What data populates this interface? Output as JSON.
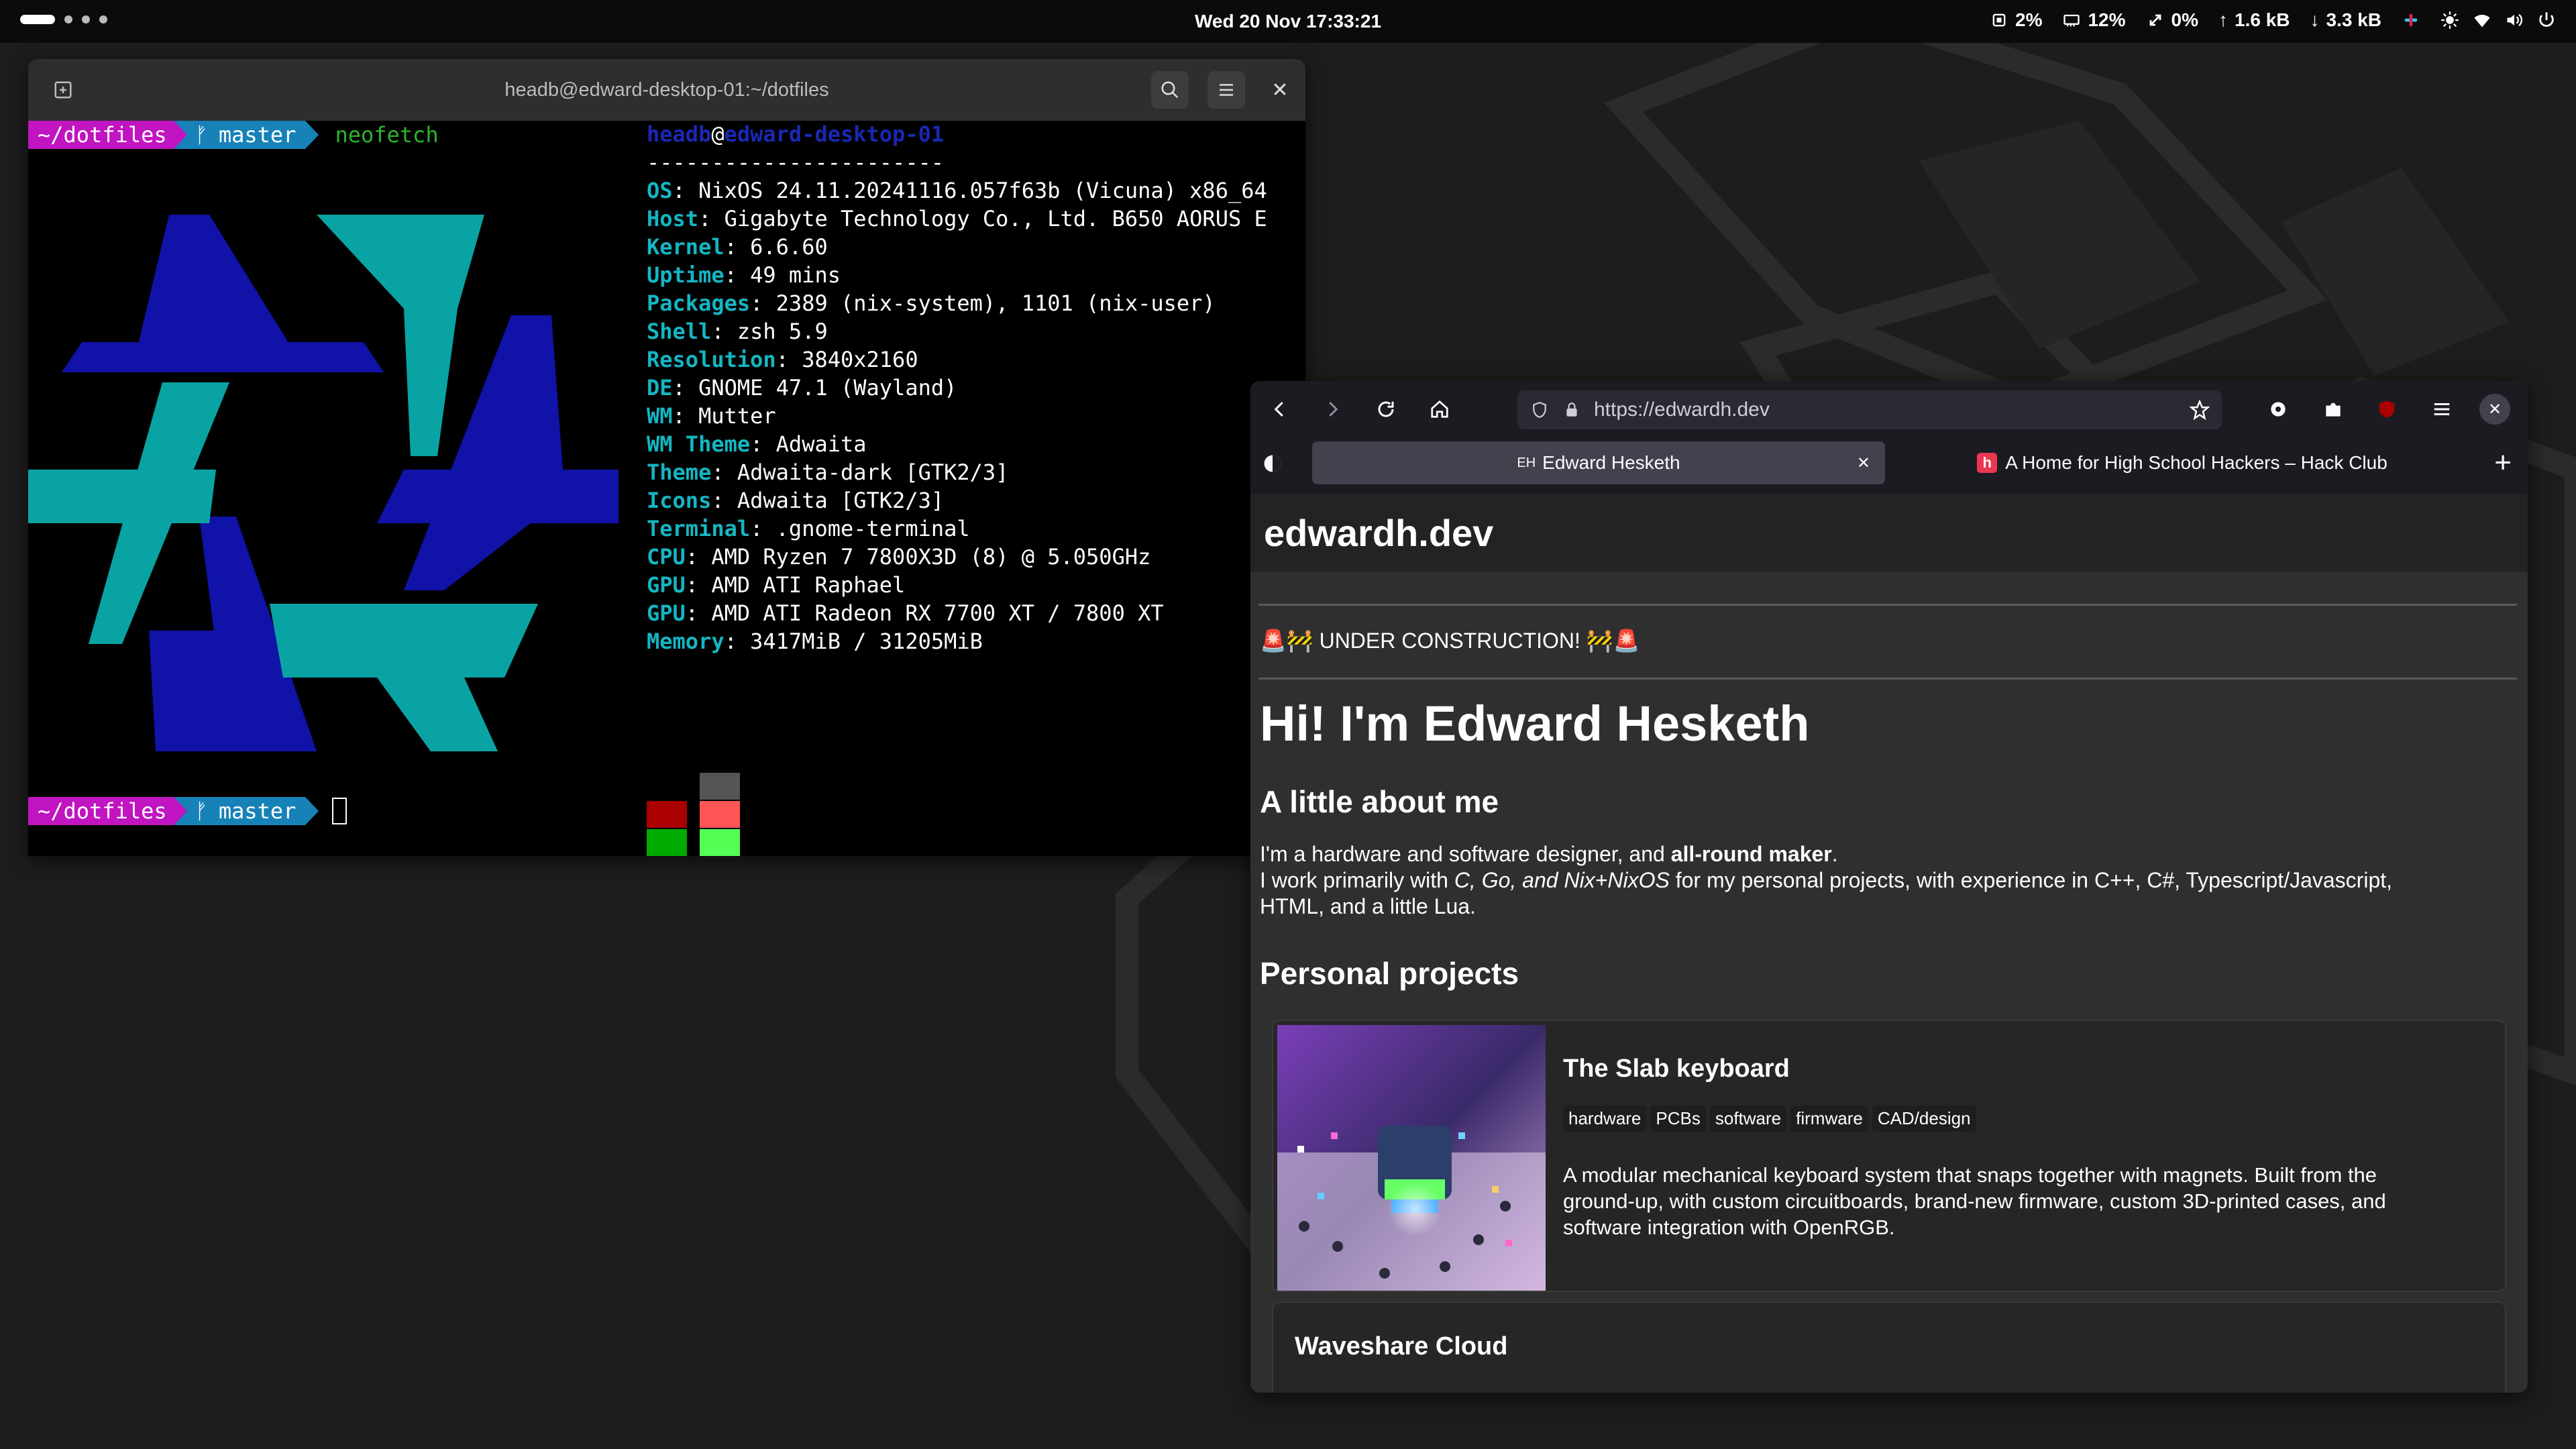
{
  "topbar": {
    "datetime": "Wed 20 Nov  17:33:21",
    "cpu": "2%",
    "ram": "12%",
    "swap": "0%",
    "net_up": "1.6 kB",
    "net_down": "3.3 kB"
  },
  "terminal": {
    "title": "headb@edward-desktop-01:~/dotfiles",
    "prompt_dir": "~/dotfiles",
    "prompt_branch": "master",
    "command": "neofetch",
    "user": "headb",
    "host": "edward-desktop-01",
    "separator": "-----------------------",
    "info": [
      {
        "key": "OS",
        "value": "NixOS 24.11.20241116.057f63b (Vicuna) x86_64"
      },
      {
        "key": "Host",
        "value": "Gigabyte Technology Co., Ltd. B650 AORUS E"
      },
      {
        "key": "Kernel",
        "value": "6.6.60"
      },
      {
        "key": "Uptime",
        "value": "49 mins"
      },
      {
        "key": "Packages",
        "value": "2389 (nix-system), 1101 (nix-user)"
      },
      {
        "key": "Shell",
        "value": "zsh 5.9"
      },
      {
        "key": "Resolution",
        "value": "3840x2160"
      },
      {
        "key": "DE",
        "value": "GNOME 47.1 (Wayland)"
      },
      {
        "key": "WM",
        "value": "Mutter"
      },
      {
        "key": "WM Theme",
        "value": "Adwaita"
      },
      {
        "key": "Theme",
        "value": "Adwaita-dark [GTK2/3]"
      },
      {
        "key": "Icons",
        "value": "Adwaita [GTK2/3]"
      },
      {
        "key": "Terminal",
        "value": ".gnome-terminal"
      },
      {
        "key": "CPU",
        "value": "AMD Ryzen 7 7800X3D (8) @ 5.050GHz"
      },
      {
        "key": "GPU",
        "value": "AMD ATI Raphael"
      },
      {
        "key": "GPU",
        "value": "AMD ATI Radeon RX 7700 XT / 7800 XT"
      },
      {
        "key": "Memory",
        "value": "3417MiB / 31205MiB"
      }
    ],
    "palette_top": [
      "#000000",
      "#aa0000",
      "#00aa00",
      "#aa5500",
      "#0000aa",
      "#aa00aa",
      "#00aaaa",
      "#aaaaaa"
    ],
    "palette_bottom": [
      "#555555",
      "#ff5555",
      "#55ff55",
      "#ffff55",
      "#5555ff",
      "#ff55ff",
      "#55ffff",
      "#ffffff"
    ]
  },
  "browser": {
    "url": "https://edwardh.dev",
    "tabs": [
      {
        "label": "Edward Hesketh",
        "favicon": "EH"
      },
      {
        "label": "A Home for High School Hackers – Hack Club",
        "favicon": "h"
      }
    ],
    "page": {
      "site_title": "edwardh.dev",
      "banner": "🚨🚧 UNDER CONSTRUCTION! 🚧🚨",
      "heading": "Hi! I'm Edward Hesketh",
      "about_heading": "A little about me",
      "about_p1_a": "I'm a hardware and software designer, and ",
      "about_p1_b": "all-round maker",
      "about_p1_c": ".",
      "about_p2_a": "I work primarily with ",
      "about_p2_b": "C, Go, and Nix+NixOS",
      "about_p2_c": " for my personal projects, with experience in C++, C#, Typescript/Javascript,",
      "about_p2_d": "HTML, and a little Lua.",
      "projects_heading": "Personal projects",
      "project1": {
        "title": "The Slab keyboard",
        "tags": [
          "hardware",
          "PCBs",
          "software",
          "firmware",
          "CAD/design"
        ],
        "desc_1": "A modular mechanical keyboard system that snaps together with magnets. Built from the",
        "desc_2": "ground-up, with custom circuitboards, brand-new firmware, custom 3D-printed cases, and",
        "desc_3": "software integration with OpenRGB."
      },
      "project2": {
        "title": "Waveshare Cloud"
      }
    }
  }
}
